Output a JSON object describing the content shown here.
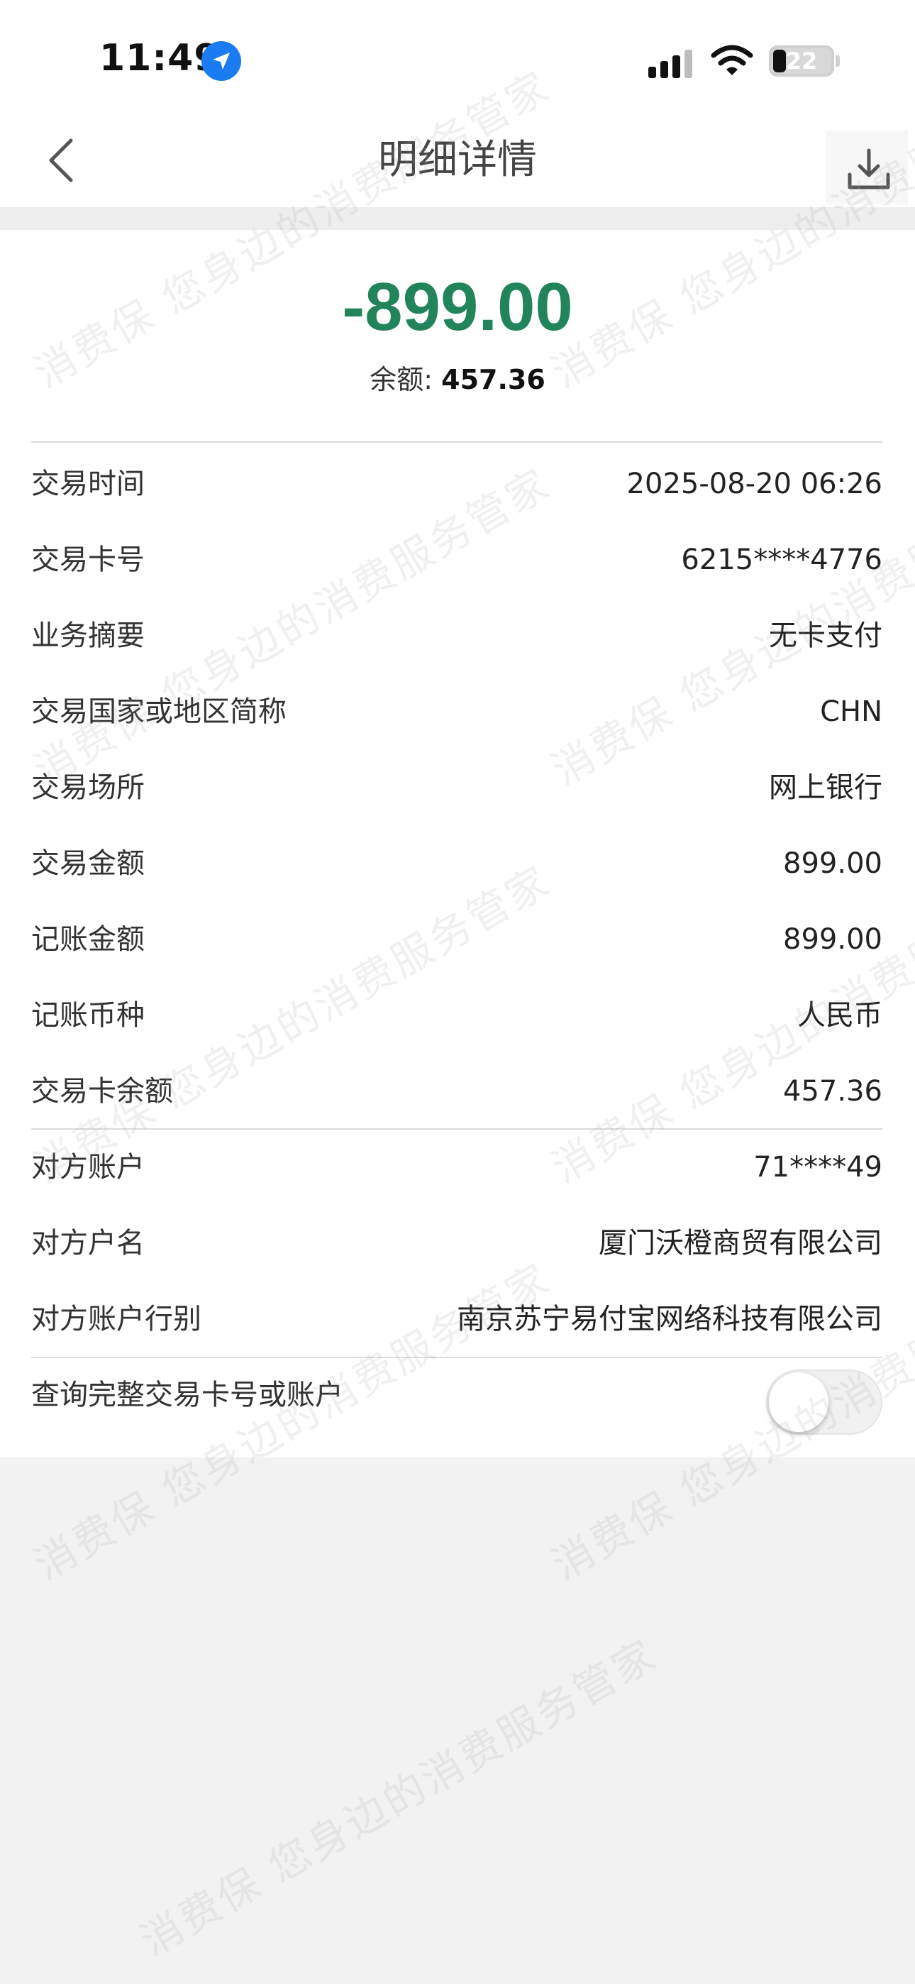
{
  "status_bar": {
    "time": "11:49",
    "battery": "22",
    "icons": [
      "location-arrow-icon",
      "cellular-signal-icon",
      "wifi-icon",
      "battery-icon"
    ]
  },
  "nav": {
    "title": "明细详情",
    "back_icon": "chevron-left-icon",
    "download_icon": "download-icon"
  },
  "summary": {
    "amount": "-899.00",
    "balance_label": "余额: ",
    "balance_value": "457.36",
    "amount_color": "#21845a"
  },
  "details": [
    {
      "label": "交易时间",
      "value": "2025-08-20 06:26"
    },
    {
      "label": "交易卡号",
      "value": "6215****4776"
    },
    {
      "label": "业务摘要",
      "value": "无卡支付"
    },
    {
      "label": "交易国家或地区简称",
      "value": "CHN"
    },
    {
      "label": "交易场所",
      "value": "网上银行"
    },
    {
      "label": "交易金额",
      "value": "899.00"
    },
    {
      "label": "记账金额",
      "value": "899.00"
    },
    {
      "label": "记账币种",
      "value": "人民币"
    },
    {
      "label": "交易卡余额",
      "value": "457.36"
    }
  ],
  "counterparty": [
    {
      "label": "对方账户",
      "value": "71****49"
    },
    {
      "label": "对方户名",
      "value": "厦门沃橙商贸有限公司"
    },
    {
      "label": "对方账户行别",
      "value": "南京苏宁易付宝网络科技有限公司"
    }
  ],
  "toggle": {
    "label": "查询完整交易卡号或账户",
    "state": "off"
  },
  "watermark": {
    "text": "消费保 您身边的消费服务管家"
  }
}
